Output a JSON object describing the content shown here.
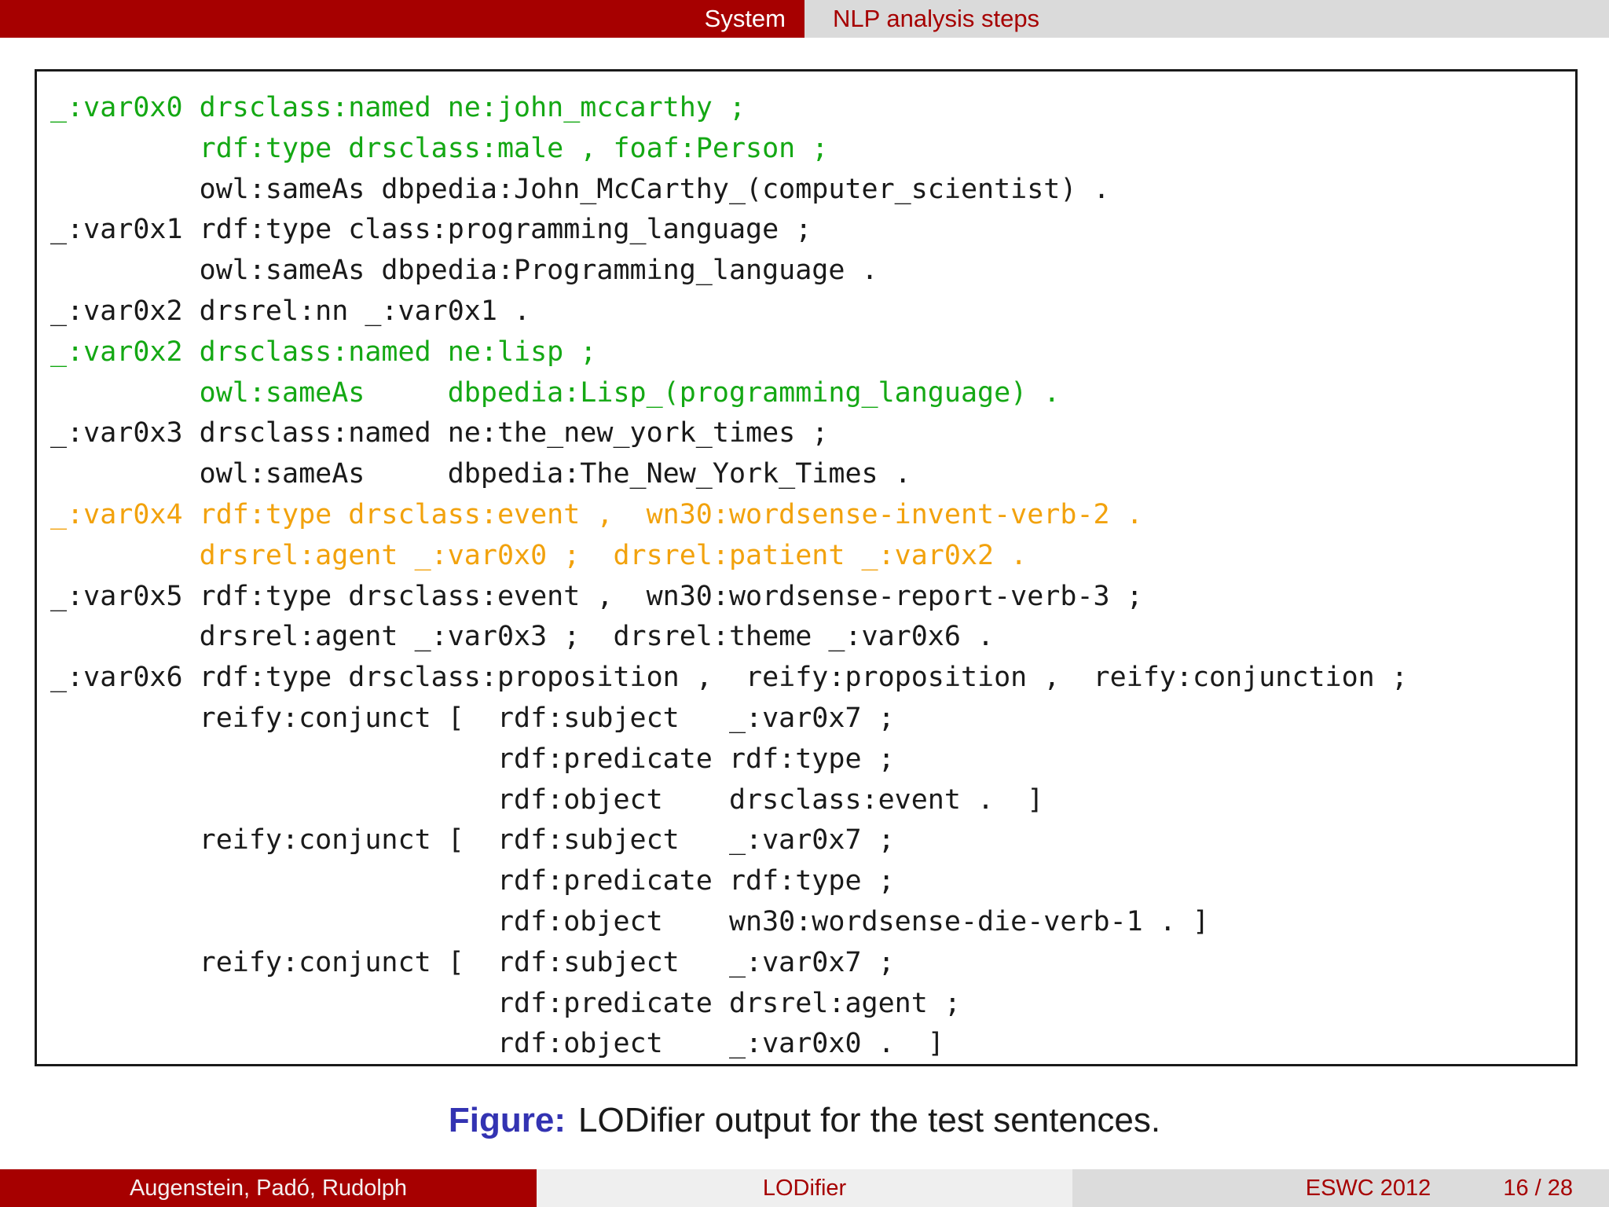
{
  "header": {
    "section": "System",
    "subsection": "NLP analysis steps"
  },
  "code_block": {
    "lines": [
      {
        "text": "_:var0x0 drsclass:named ne:john_mccarthy ;",
        "color": "green"
      },
      {
        "text": "         rdf:type drsclass:male , foaf:Person ;",
        "color": "green"
      },
      {
        "text": "         owl:sameAs dbpedia:John_McCarthy_(computer_scientist) .",
        "color": "black"
      },
      {
        "text": "_:var0x1 rdf:type class:programming_language ;",
        "color": "black"
      },
      {
        "text": "         owl:sameAs dbpedia:Programming_language .",
        "color": "black"
      },
      {
        "text": "_:var0x2 drsrel:nn _:var0x1 .",
        "color": "black"
      },
      {
        "text": "_:var0x2 drsclass:named ne:lisp ;",
        "color": "green"
      },
      {
        "text": "         owl:sameAs     dbpedia:Lisp_(programming_language) .",
        "color": "green"
      },
      {
        "text": "_:var0x3 drsclass:named ne:the_new_york_times ;",
        "color": "black"
      },
      {
        "text": "         owl:sameAs     dbpedia:The_New_York_Times .",
        "color": "black"
      },
      {
        "text": "_:var0x4 rdf:type drsclass:event ,  wn30:wordsense-invent-verb-2 .",
        "color": "orange"
      },
      {
        "text": "         drsrel:agent _:var0x0 ;  drsrel:patient _:var0x2 .",
        "color": "orange"
      },
      {
        "text": "_:var0x5 rdf:type drsclass:event ,  wn30:wordsense-report-verb-3 ;",
        "color": "black"
      },
      {
        "text": "         drsrel:agent _:var0x3 ;  drsrel:theme _:var0x6 .",
        "color": "black"
      },
      {
        "text": "_:var0x6 rdf:type drsclass:proposition ,  reify:proposition ,  reify:conjunction ;",
        "color": "black"
      },
      {
        "text": "         reify:conjunct [  rdf:subject   _:var0x7 ;",
        "color": "black"
      },
      {
        "text": "                           rdf:predicate rdf:type ;",
        "color": "black"
      },
      {
        "text": "                           rdf:object    drsclass:event .  ]",
        "color": "black"
      },
      {
        "text": "         reify:conjunct [  rdf:subject   _:var0x7 ;",
        "color": "black"
      },
      {
        "text": "                           rdf:predicate rdf:type ;",
        "color": "black"
      },
      {
        "text": "                           rdf:object    wn30:wordsense-die-verb-1 . ]",
        "color": "black"
      },
      {
        "text": "         reify:conjunct [  rdf:subject   _:var0x7 ;",
        "color": "black"
      },
      {
        "text": "                           rdf:predicate drsrel:agent ;",
        "color": "black"
      },
      {
        "text": "                           rdf:object    _:var0x0 .  ]",
        "color": "black"
      }
    ]
  },
  "caption": {
    "label": "Figure:",
    "text": "LODifier output for the test sentences."
  },
  "footer": {
    "authors": "Augenstein, Padó, Rudolph",
    "short_title": "LODifier",
    "conference": "ESWC 2012",
    "slide_number": "16 / 28"
  },
  "colors": {
    "accent_red": "#A60000",
    "header_gray": "#DADADA",
    "footer_mid_gray": "#EFEFEF",
    "footer_right_gray": "#DCDCDC",
    "code_green": "#14A814",
    "code_orange": "#F2A20D",
    "code_black": "#1A1A1A",
    "figure_blue": "#3333B2",
    "box_border": "#1A1A1A"
  }
}
